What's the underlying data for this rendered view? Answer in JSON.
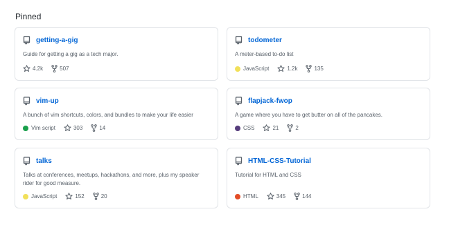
{
  "section": {
    "title": "Pinned"
  },
  "repos": [
    {
      "name": "getting-a-gig",
      "description": "Guide for getting a gig as a tech major.",
      "language": "",
      "language_color": "",
      "stars": "4.2k",
      "forks": "507"
    },
    {
      "name": "todometer",
      "description": "A meter-based to-do list",
      "language": "JavaScript",
      "language_color": "#f1e05a",
      "stars": "1.2k",
      "forks": "135"
    },
    {
      "name": "vim-up",
      "description": "A bunch of vim shortcuts, colors, and bundles to make your life easier",
      "language": "Vim script",
      "language_color": "#199f4b",
      "stars": "303",
      "forks": "14"
    },
    {
      "name": "flapjack-fwop",
      "description": "A game where you have to get butter on all of the pancakes.",
      "language": "CSS",
      "language_color": "#563d7c",
      "stars": "21",
      "forks": "2"
    },
    {
      "name": "talks",
      "description": "Talks at conferences, meetups, hackathons, and more, plus my speaker rider for good measure.",
      "language": "JavaScript",
      "language_color": "#f1e05a",
      "stars": "152",
      "forks": "20"
    },
    {
      "name": "HTML-CSS-Tutorial",
      "description": "Tutorial for HTML and CSS",
      "language": "HTML",
      "language_color": "#e34c26",
      "stars": "345",
      "forks": "144"
    }
  ],
  "icons": {
    "repo": "repo-icon",
    "star": "star-icon",
    "fork": "fork-icon"
  }
}
